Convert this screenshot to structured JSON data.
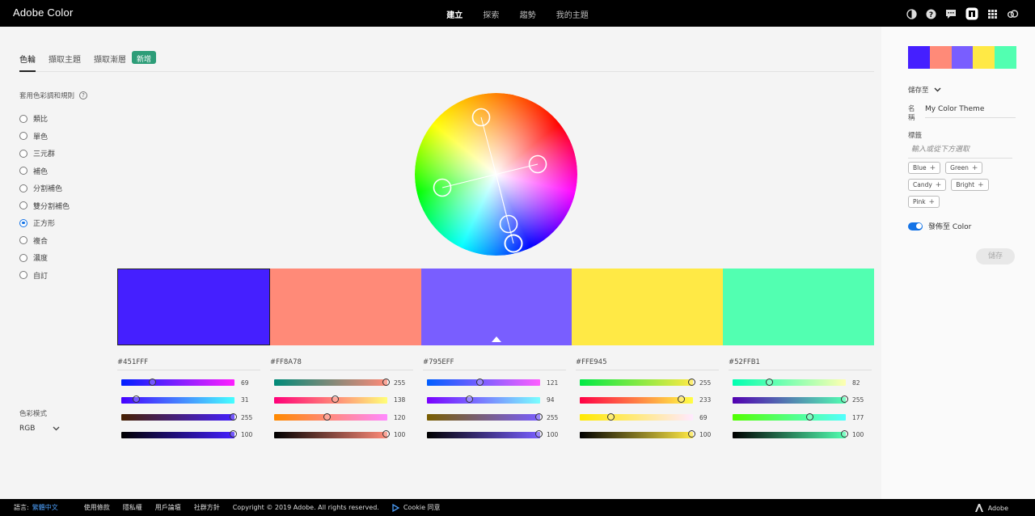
{
  "app": {
    "title": "Adobe Color"
  },
  "nav": [
    {
      "label": "建立",
      "active": true
    },
    {
      "label": "探索",
      "active": false
    },
    {
      "label": "趨勢",
      "active": false
    },
    {
      "label": "我的主題",
      "active": false
    }
  ],
  "top_icons": [
    "contrast-icon",
    "help-icon",
    "chat-icon",
    "behance-icon",
    "apps-grid-icon",
    "creative-cloud-icon"
  ],
  "tabs": [
    {
      "label": "色輪",
      "active": true
    },
    {
      "label": "擷取主題",
      "active": false
    },
    {
      "label": "擷取漸層",
      "active": false
    }
  ],
  "new_badge": "新增",
  "harmony": {
    "title": "套用色彩調和規則",
    "selected": 6,
    "rules": [
      "類比",
      "單色",
      "三元群",
      "補色",
      "分割補色",
      "雙分割補色",
      "正方形",
      "複合",
      "濃度",
      "自訂"
    ]
  },
  "color_mode": {
    "label": "色彩模式",
    "value": "RGB"
  },
  "colors": [
    {
      "hex": "#451FFF",
      "fill": "#451FFF",
      "values": [
        69,
        31,
        255,
        100
      ],
      "fractions": [
        0.27,
        0.12,
        1.0,
        1.0
      ],
      "gradients": [
        "linear-gradient(90deg,#001fff,#ff1fff)",
        "linear-gradient(90deg,#4500ff,#45ffff)",
        "linear-gradient(90deg,#451f00,#451fff)",
        "linear-gradient(90deg,#000,#451fff)"
      ]
    },
    {
      "hex": "#FF8A78",
      "fill": "#FF8A78",
      "values": [
        255,
        138,
        120,
        100
      ],
      "fractions": [
        1.0,
        0.54,
        0.47,
        1.0
      ],
      "gradients": [
        "linear-gradient(90deg,#008a78,#ff8a78)",
        "linear-gradient(90deg,#ff0078,#ffff78)",
        "linear-gradient(90deg,#ff8a00,#ff8aff)",
        "linear-gradient(90deg,#000,#ff8a78)"
      ]
    },
    {
      "hex": "#795EFF",
      "fill": "#795EFF",
      "values": [
        121,
        94,
        255,
        100
      ],
      "fractions": [
        0.47,
        0.37,
        1.0,
        1.0
      ],
      "gradients": [
        "linear-gradient(90deg,#005eff,#ff5eff)",
        "linear-gradient(90deg,#7900ff,#79ffff)",
        "linear-gradient(90deg,#795e00,#795eff)",
        "linear-gradient(90deg,#000,#795eff)"
      ]
    },
    {
      "hex": "#FFE945",
      "fill": "#FFE945",
      "values": [
        255,
        233,
        69,
        100
      ],
      "fractions": [
        1.0,
        0.91,
        0.27,
        1.0
      ],
      "gradients": [
        "linear-gradient(90deg,#00e945,#ffe945)",
        "linear-gradient(90deg,#ff0045,#ffff45)",
        "linear-gradient(90deg,#ffe900,#ffe9ff)",
        "linear-gradient(90deg,#000,#ffe945)"
      ]
    },
    {
      "hex": "#52FFB1",
      "fill": "#52FFB1",
      "values": [
        82,
        255,
        177,
        100
      ],
      "fractions": [
        0.32,
        1.0,
        0.69,
        1.0
      ],
      "gradients": [
        "linear-gradient(90deg,#00ffb1,#ffffb1)",
        "linear-gradient(90deg,#5200b1,#52ffb1)",
        "linear-gradient(90deg,#52ff00,#52ffff)",
        "linear-gradient(90deg,#000,#52ffb1)"
      ]
    }
  ],
  "selected_swatch": 2,
  "side": {
    "save_to": "儲存至",
    "name_label": "名稱",
    "name_value": "My Color Theme",
    "tags_label": "標籤",
    "tags_placeholder": "輸入或從下方選取",
    "tags": [
      "Blue",
      "Green",
      "Candy",
      "Bright",
      "Pink"
    ],
    "publish_label": "發佈至 Color",
    "publish_on": true,
    "save_button": "儲存"
  },
  "footer": {
    "language_label": "語言:",
    "language_value": "繁體中文",
    "links": [
      "使用條款",
      "隱私權",
      "用戶論壇",
      "社群方針"
    ],
    "copyright": "Copyright © 2019 Adobe. All rights reserved.",
    "cookie": "Cookie 同意",
    "adobe": "Adobe"
  }
}
